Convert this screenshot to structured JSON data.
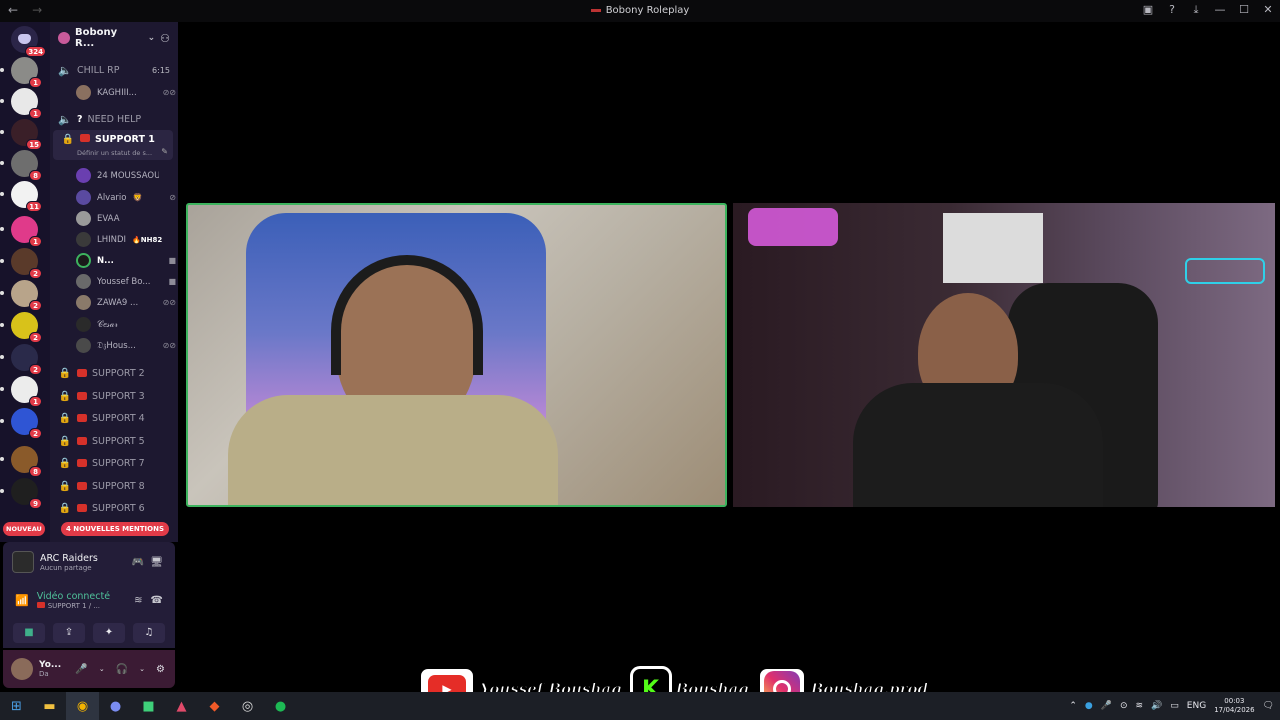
{
  "window": {
    "title": "Bobony Roleplay",
    "back_icon": "arrow-left",
    "forward_icon": "arrow-right"
  },
  "guild_rail": {
    "dm_badge": "324",
    "badges": [
      "1",
      "1",
      "15",
      "8",
      "11",
      "1",
      "2",
      "2",
      "2",
      "2",
      "1",
      "2",
      "8",
      "9"
    ],
    "new_label": "NOUVEAU"
  },
  "server": {
    "name": "Bobony R...",
    "channels": {
      "chill_rp": {
        "name": "CHILL RP",
        "time": "6:15"
      },
      "need_help": {
        "name": "NEED HELP",
        "prefix": "?"
      },
      "support1": {
        "name": "SUPPORT 1",
        "status": "Définir un statut de s..."
      },
      "support2": "SUPPORT 2",
      "support3": "SUPPORT 3",
      "support4": "SUPPORT 4",
      "support5": "SUPPORT 5",
      "support7": "SUPPORT 7",
      "support8": "SUPPORT 8",
      "support6": "SUPPORT 6"
    },
    "chill_users": [
      "KAGHIII..."
    ],
    "support1_users": [
      "24 MOUSSAOUI",
      "Alvario",
      "EVAA",
      "LHINDI",
      "N...",
      "Youssef Bo...",
      "ZAWA9 ...",
      "𝒞𝑒𝓈𝒶𝓇",
      "𝔇𝔷Hous..."
    ],
    "lhindi_tag": "NH82",
    "mentions_pill": "4 NOUVELLES MENTIONS"
  },
  "activity": {
    "game": "ARC Raiders",
    "status": "Aucun partage"
  },
  "voice": {
    "status": "Vidéo connecté",
    "channel": "SUPPORT 1 / ..."
  },
  "user": {
    "name": "Yo...",
    "status": "Da"
  },
  "overlay": {
    "youtube": "Youssef Boushaq",
    "kick": "Boushaq",
    "instagram": "Boushaq.prod"
  },
  "taskbar": {
    "lang": "ENG",
    "time": "00:03",
    "date": "17/04/2026"
  },
  "colors": {
    "accent_green": "#3db35e",
    "badge_red": "#e23b48",
    "sidebar": "#1d1830"
  }
}
